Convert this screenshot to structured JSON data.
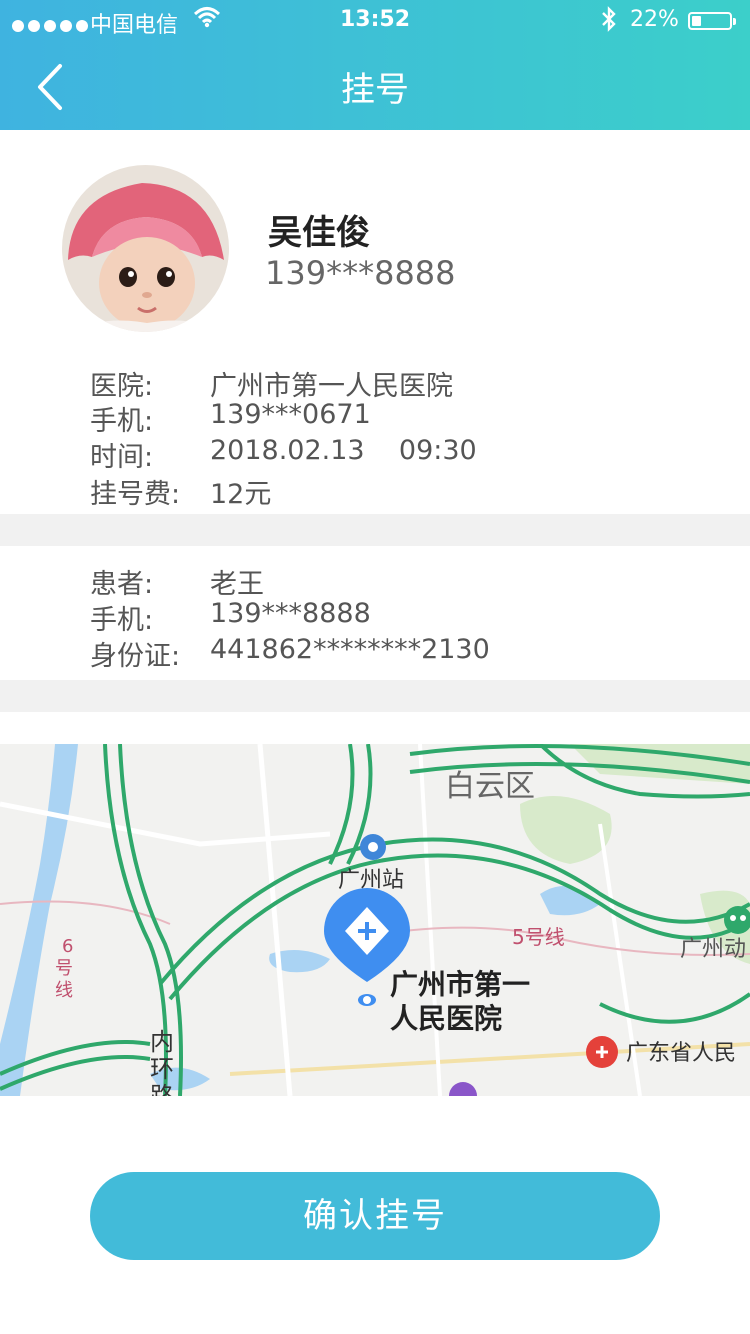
{
  "status_bar": {
    "carrier": "中国电信",
    "time": "13:52",
    "battery": "22%",
    "battery_level": 0.22
  },
  "nav": {
    "title": "挂号",
    "back_icon": "chevron-left-icon"
  },
  "profile": {
    "name": "吴佳俊",
    "phone": "139***8888"
  },
  "appointment": {
    "rows": [
      {
        "label": "医院:",
        "value": "广州市第一人民医院"
      },
      {
        "label": "手机:",
        "value": "139***0671"
      },
      {
        "label": "时间:",
        "value": "2018.02.13    09:30"
      },
      {
        "label": "挂号费:",
        "value": "12元"
      }
    ]
  },
  "patient": {
    "rows": [
      {
        "label": "患者:",
        "value": "老王"
      },
      {
        "label": "手机:",
        "value": "139***8888"
      },
      {
        "label": "身份证:",
        "value": "441862********2130"
      }
    ]
  },
  "map": {
    "district": "白云区",
    "station": "广州站",
    "line5": "5号线",
    "line6_a": "6",
    "line6_b": "号",
    "line6_c": "线",
    "ring_a": "内",
    "ring_b": "环",
    "ring_c": "路",
    "hospital_line1": "广州市第一",
    "hospital_line2": "人民医院",
    "zoo": "广州动",
    "provincial": "广东省人民",
    "colors": {
      "road": "#2fa86b",
      "water": "#aad3f3",
      "park": "#d8eacb",
      "marker": "#3f8ef0"
    }
  },
  "confirm_button": "确认挂号",
  "colors": {
    "header_start": "#3fb3e0",
    "header_end": "#3ccfca",
    "button": "#42bbd9"
  }
}
